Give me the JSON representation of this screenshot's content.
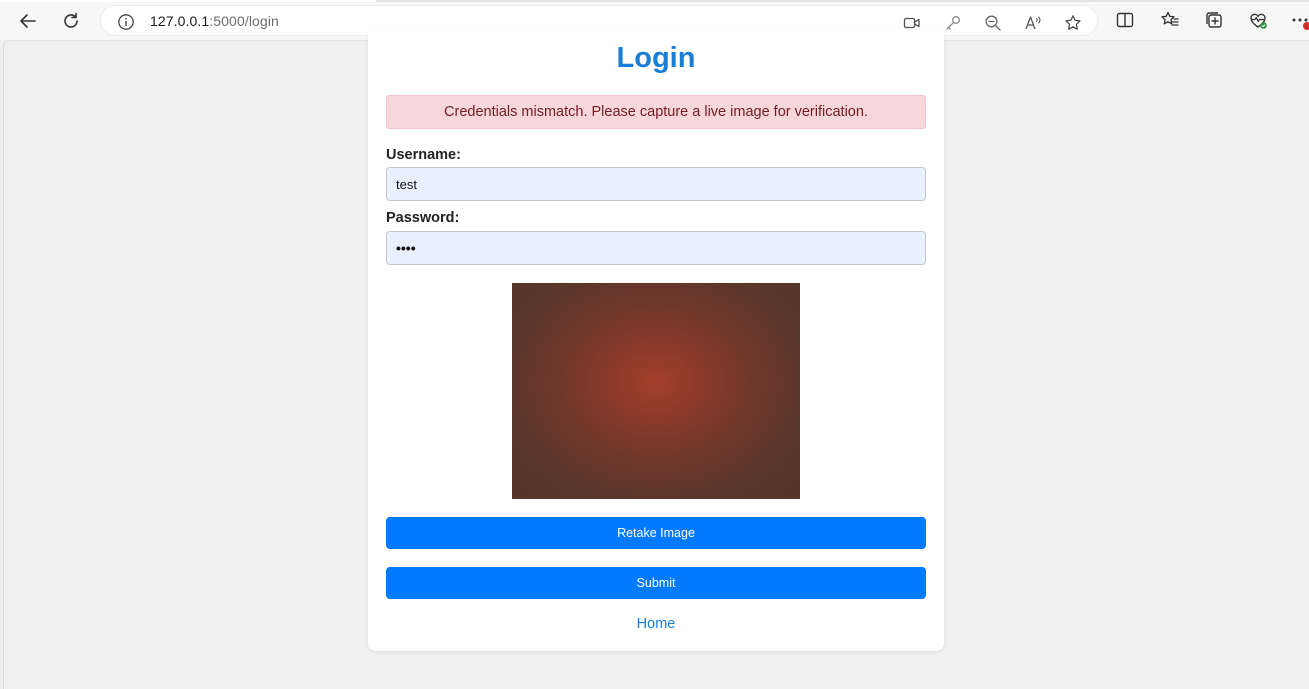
{
  "browser": {
    "url_host": "127.0.0.1",
    "url_path": ":5000/login",
    "icons": {
      "back": "back-arrow-icon",
      "refresh": "refresh-icon",
      "info": "info-icon",
      "camera": "video-camera-icon",
      "key": "key-icon",
      "zoom_out": "zoom-out-icon",
      "read_aloud": "read-aloud-icon",
      "favorite": "star-icon",
      "split_screen": "split-screen-icon",
      "favorites": "favorites-icon",
      "collections": "collections-icon",
      "browser_essentials": "browser-essentials-icon",
      "more": "more-icon"
    }
  },
  "login": {
    "title": "Login",
    "alert": "Credentials mismatch. Please capture a live image for verification.",
    "username_label": "Username:",
    "username_value": "test",
    "password_label": "Password:",
    "password_value": "••••",
    "retake_label": "Retake Image",
    "submit_label": "Submit",
    "home_label": "Home"
  },
  "colors": {
    "accent": "#007bff",
    "title": "#1b7ed6",
    "alert_bg": "#f8d7da",
    "alert_text": "#721c24",
    "input_bg": "#e8f0fe"
  }
}
